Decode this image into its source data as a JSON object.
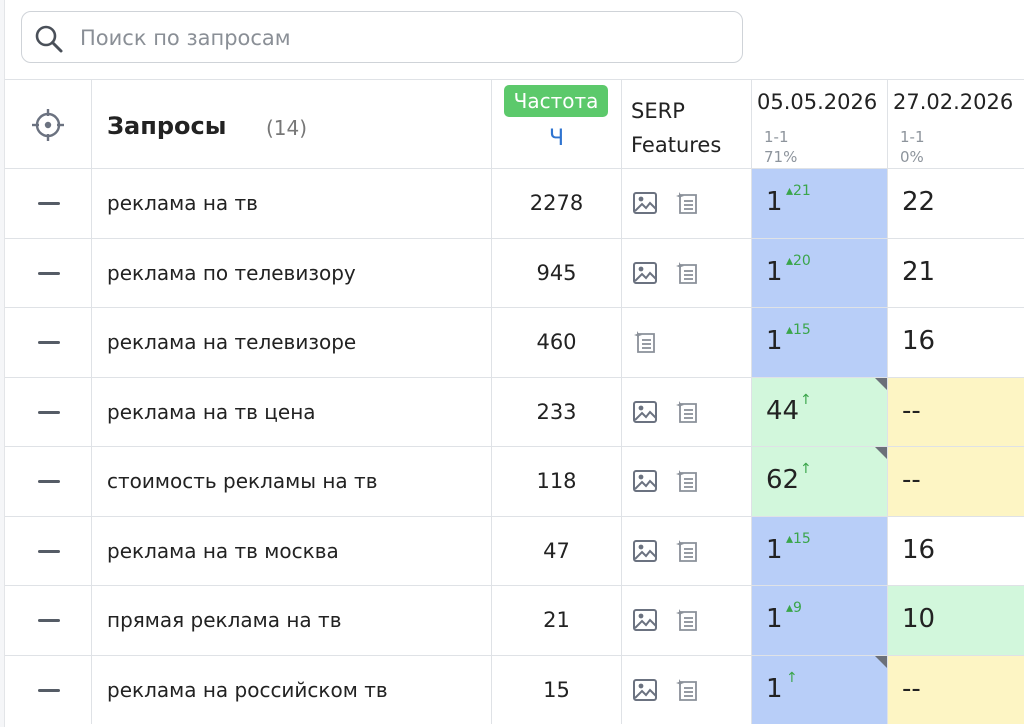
{
  "search": {
    "placeholder": "Поиск по запросам",
    "value": ""
  },
  "header": {
    "target_icon": "crosshair-icon",
    "queries_label": "Запросы",
    "queries_count": "(14)",
    "freq_badge": "Частота",
    "freq_sub": "Ч",
    "serp_label_line1": "SERP",
    "serp_label_line2": "Features",
    "date1": {
      "date": "05.05.2026",
      "range": "1-1",
      "percent": "71%"
    },
    "date2": {
      "date": "27.02.2026",
      "range": "1-1",
      "percent": "0%"
    }
  },
  "colors": {
    "badge_green": "#5cc96b",
    "position_blue": "#b8cef8",
    "position_green": "#d2f7dc",
    "position_yellow": "#fdf5c4",
    "change_green": "#3aa54a"
  },
  "rows": [
    {
      "query": "реклама на тв",
      "freq": "2278",
      "serp": [
        "image-icon",
        "featured-snippet-icon"
      ],
      "d1": {
        "pos": "1",
        "change": "▴21",
        "color": "blue",
        "corner": false
      },
      "d2": {
        "pos": "22",
        "color": "white"
      }
    },
    {
      "query": "реклама по телевизору",
      "freq": "945",
      "serp": [
        "image-icon",
        "featured-snippet-icon"
      ],
      "d1": {
        "pos": "1",
        "change": "▴20",
        "color": "blue",
        "corner": false
      },
      "d2": {
        "pos": "21",
        "color": "white"
      }
    },
    {
      "query": "реклама на телевизоре",
      "freq": "460",
      "serp": [
        "featured-snippet-icon"
      ],
      "d1": {
        "pos": "1",
        "change": "▴15",
        "color": "blue",
        "corner": false
      },
      "d2": {
        "pos": "16",
        "color": "white"
      }
    },
    {
      "query": "реклама на тв цена",
      "freq": "233",
      "serp": [
        "image-icon",
        "featured-snippet-icon"
      ],
      "d1": {
        "pos": "44",
        "change": "↑",
        "color": "green",
        "corner": true
      },
      "d2": {
        "pos": "--",
        "color": "yellow"
      }
    },
    {
      "query": "стоимость рекламы на тв",
      "freq": "118",
      "serp": [
        "image-icon",
        "featured-snippet-icon"
      ],
      "d1": {
        "pos": "62",
        "change": "↑",
        "color": "green",
        "corner": true
      },
      "d2": {
        "pos": "--",
        "color": "yellow"
      }
    },
    {
      "query": "реклама на тв москва",
      "freq": "47",
      "serp": [
        "image-icon",
        "featured-snippet-icon"
      ],
      "d1": {
        "pos": "1",
        "change": "▴15",
        "color": "blue",
        "corner": false
      },
      "d2": {
        "pos": "16",
        "color": "white"
      }
    },
    {
      "query": "прямая реклама на тв",
      "freq": "21",
      "serp": [
        "image-icon",
        "featured-snippet-icon"
      ],
      "d1": {
        "pos": "1",
        "change": "▴9",
        "color": "blue",
        "corner": false
      },
      "d2": {
        "pos": "10",
        "color": "green"
      }
    },
    {
      "query": "реклама на российском тв",
      "freq": "15",
      "serp": [
        "image-icon",
        "featured-snippet-icon"
      ],
      "d1": {
        "pos": "1",
        "change": "↑",
        "color": "blue",
        "corner": true
      },
      "d2": {
        "pos": "--",
        "color": "yellow"
      }
    }
  ]
}
